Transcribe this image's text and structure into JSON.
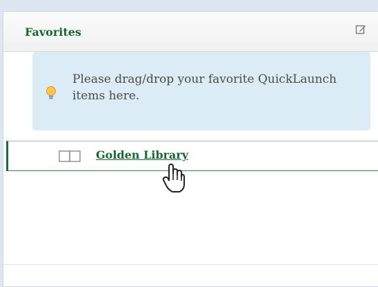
{
  "favorites": {
    "title": "Favorites",
    "edit_icon": "edit-icon",
    "hint": {
      "icon": "lightbulb-icon",
      "text": "Please drag/drop your favorite QuickLaunch items here."
    },
    "items": [
      {
        "icon": "book-icon",
        "label": "Golden Library"
      }
    ]
  },
  "colors": {
    "accent_green": "#186636",
    "page_background": "#dde7f3",
    "hint_background": "#dcecf6"
  }
}
